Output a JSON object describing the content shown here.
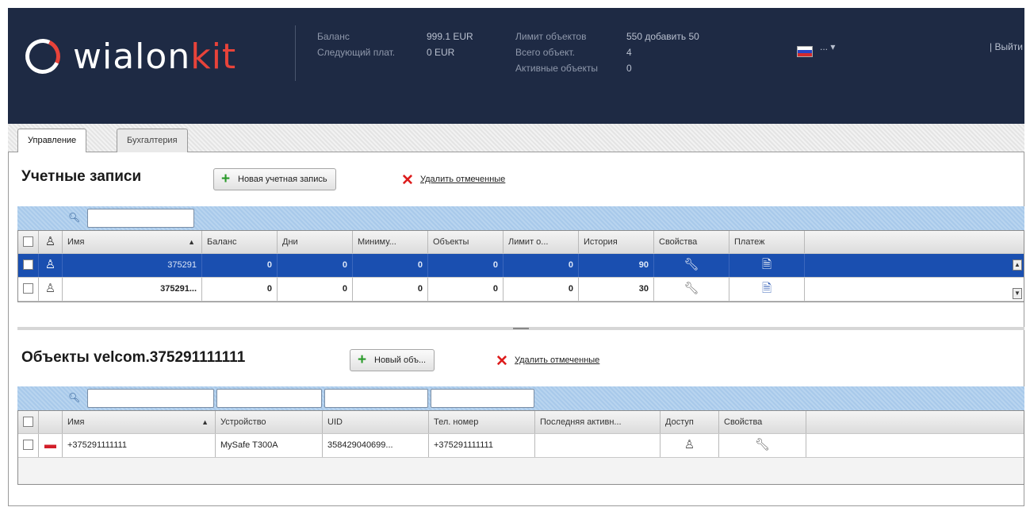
{
  "header": {
    "logo_main": "wialon",
    "logo_kit": "kit",
    "balance_label": "Баланс",
    "balance_value": "999.1 EUR",
    "next_payment_label": "Следующий плат.",
    "next_payment_value": "0 EUR",
    "limit_label": "Лимит объектов",
    "limit_value": "550 добавить 50",
    "total_label": "Всего объект.",
    "total_value": "4",
    "active_label": "Активные объекты",
    "active_value": "0",
    "language_value": "...",
    "logout_label": "| Выйти"
  },
  "tabs": [
    {
      "label": "Управление",
      "active": true
    },
    {
      "label": "Бухгалтерия",
      "active": false
    }
  ],
  "accounts": {
    "title": "Учетные записи",
    "new_button": "Новая учетная запись",
    "delete_link": "Удалить отмеченные",
    "columns": [
      "Имя",
      "Баланс",
      "Дни",
      "Миниму...",
      "Объекты",
      "Лимит о...",
      "История",
      "Свойства",
      "Платеж"
    ],
    "rows": [
      {
        "name": "375291",
        "balance": "0",
        "days": "0",
        "minimum": "0",
        "objects": "0",
        "limit": "0",
        "history": "90",
        "selected": true
      },
      {
        "name": "375291...",
        "balance": "0",
        "days": "0",
        "minimum": "0",
        "objects": "0",
        "limit": "0",
        "history": "30",
        "selected": false
      }
    ]
  },
  "objects": {
    "title": "Объекты velcom.375291111111",
    "new_button": "Новый объ...",
    "delete_link": "Удалить отмеченные",
    "columns": [
      "Имя",
      "Устройство",
      "UID",
      "Тел. номер",
      "Последняя активн...",
      "Доступ",
      "Свойства"
    ],
    "rows": [
      {
        "name": "+375291111111",
        "device": "MySafe T300A",
        "uid": "358429040699...",
        "phone": "+375291111111",
        "last_active": ""
      }
    ]
  },
  "icons": {
    "properties": "wrench-icon",
    "payment": "document-icon",
    "access": "user-key-icon",
    "object_type": "car-icon"
  },
  "colors": {
    "header_bg": "#1e2a44",
    "accent_red": "#e8433a",
    "selected_row": "#1a4fb0",
    "filter_bar": "#a8c9ea"
  }
}
